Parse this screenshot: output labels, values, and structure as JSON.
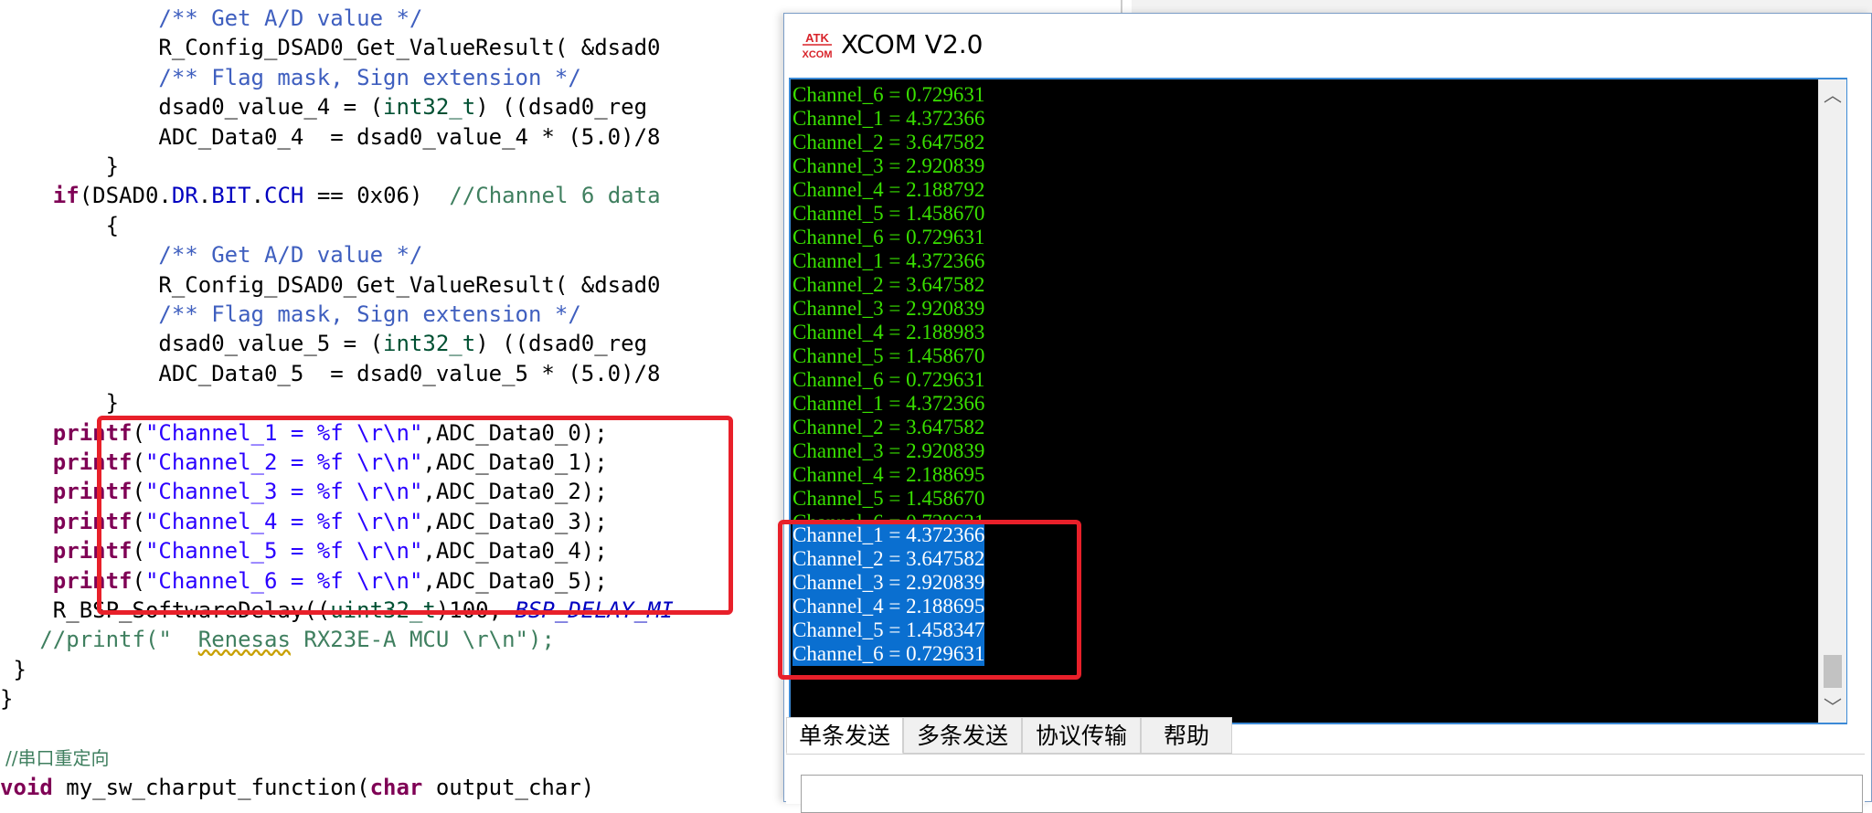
{
  "editor": {
    "lines": [
      {
        "indent": "            ",
        "parts": [
          {
            "t": "/** Get A/D value */",
            "c": "comment"
          }
        ]
      },
      {
        "indent": "            ",
        "parts": [
          {
            "t": "R_Config_DSAD0_Get_ValueResult( &dsad0",
            "c": ""
          }
        ]
      },
      {
        "indent": "            ",
        "parts": [
          {
            "t": "/** Flag mask, Sign extension */",
            "c": "comment"
          }
        ]
      },
      {
        "indent": "            ",
        "parts": [
          {
            "t": "dsad0_value_4 = (",
            "c": ""
          },
          {
            "t": "int32_t",
            "c": "type"
          },
          {
            "t": ") ((dsad0_reg",
            "c": ""
          }
        ]
      },
      {
        "indent": "            ",
        "parts": [
          {
            "t": "ADC_Data0_4  = dsad0_value_4 * (5.0)/8",
            "c": ""
          }
        ]
      },
      {
        "indent": "        ",
        "parts": [
          {
            "t": "}",
            "c": ""
          }
        ]
      },
      {
        "indent": "    ",
        "parts": [
          {
            "t": "if",
            "c": "kw"
          },
          {
            "t": "(DSAD0.",
            "c": ""
          },
          {
            "t": "DR",
            "c": "field"
          },
          {
            "t": ".",
            "c": ""
          },
          {
            "t": "BIT",
            "c": "field"
          },
          {
            "t": ".",
            "c": ""
          },
          {
            "t": "CCH",
            "c": "field"
          },
          {
            "t": " == 0x06)  ",
            "c": ""
          },
          {
            "t": "//Channel 6 data",
            "c": "green"
          }
        ]
      },
      {
        "indent": "        ",
        "parts": [
          {
            "t": "{",
            "c": ""
          }
        ]
      },
      {
        "indent": "            ",
        "parts": [
          {
            "t": "/** Get A/D value */",
            "c": "comment"
          }
        ]
      },
      {
        "indent": "            ",
        "parts": [
          {
            "t": "R_Config_DSAD0_Get_ValueResult( &dsad0",
            "c": ""
          }
        ]
      },
      {
        "indent": "            ",
        "parts": [
          {
            "t": "/** Flag mask, Sign extension */",
            "c": "comment"
          }
        ]
      },
      {
        "indent": "            ",
        "parts": [
          {
            "t": "dsad0_value_5 = (",
            "c": ""
          },
          {
            "t": "int32_t",
            "c": "type"
          },
          {
            "t": ") ((dsad0_reg",
            "c": ""
          }
        ]
      },
      {
        "indent": "            ",
        "parts": [
          {
            "t": "ADC_Data0_5  = dsad0_value_5 * (5.0)/8",
            "c": ""
          }
        ]
      },
      {
        "indent": "        ",
        "parts": [
          {
            "t": "}",
            "c": ""
          }
        ]
      },
      {
        "indent": "    ",
        "parts": [
          {
            "t": "printf",
            "c": "kw"
          },
          {
            "t": "(",
            "c": ""
          },
          {
            "t": "\"Channel_1 = %f \\r\\n\"",
            "c": "str"
          },
          {
            "t": ",ADC_Data0_0);",
            "c": ""
          }
        ]
      },
      {
        "indent": "    ",
        "parts": [
          {
            "t": "printf",
            "c": "kw"
          },
          {
            "t": "(",
            "c": ""
          },
          {
            "t": "\"Channel_2 = %f \\r\\n\"",
            "c": "str"
          },
          {
            "t": ",ADC_Data0_1);",
            "c": ""
          }
        ]
      },
      {
        "indent": "    ",
        "parts": [
          {
            "t": "printf",
            "c": "kw"
          },
          {
            "t": "(",
            "c": ""
          },
          {
            "t": "\"Channel_3 = %f \\r\\n\"",
            "c": "str"
          },
          {
            "t": ",ADC_Data0_2);",
            "c": ""
          }
        ]
      },
      {
        "indent": "    ",
        "parts": [
          {
            "t": "printf",
            "c": "kw"
          },
          {
            "t": "(",
            "c": ""
          },
          {
            "t": "\"Channel_4 = %f \\r\\n\"",
            "c": "str"
          },
          {
            "t": ",ADC_Data0_3);",
            "c": ""
          }
        ]
      },
      {
        "indent": "    ",
        "parts": [
          {
            "t": "printf",
            "c": "kw"
          },
          {
            "t": "(",
            "c": ""
          },
          {
            "t": "\"Channel_5 = %f \\r\\n\"",
            "c": "str"
          },
          {
            "t": ",ADC_Data0_4);",
            "c": ""
          }
        ]
      },
      {
        "indent": "    ",
        "parts": [
          {
            "t": "printf",
            "c": "kw"
          },
          {
            "t": "(",
            "c": ""
          },
          {
            "t": "\"Channel_6 = %f \\r\\n\"",
            "c": "str"
          },
          {
            "t": ",ADC_Data0_5);",
            "c": ""
          }
        ]
      },
      {
        "indent": "    ",
        "parts": [
          {
            "t": "R_BSP_SoftwareDelay((",
            "c": ""
          },
          {
            "t": "uint32_t",
            "c": "type"
          },
          {
            "t": ")100, ",
            "c": ""
          },
          {
            "t": "BSP_DELAY_MI",
            "c": "ital"
          }
        ]
      },
      {
        "indent": "   ",
        "parts": [
          {
            "t": "//printf(\"  ",
            "c": "green"
          },
          {
            "t": "Renesas",
            "c": "green-under"
          },
          {
            "t": " RX23E-A MCU \\r\\n\");",
            "c": "green"
          }
        ]
      },
      {
        "indent": " ",
        "parts": [
          {
            "t": "}",
            "c": ""
          }
        ]
      },
      {
        "indent": "",
        "parts": [
          {
            "t": "}",
            "c": ""
          }
        ]
      },
      {
        "indent": "",
        "parts": []
      },
      {
        "indent": "",
        "parts": []
      },
      {
        "indent": "",
        "parts": [
          {
            "t": "void",
            "c": "kw"
          },
          {
            "t": " my_sw_charput_function(",
            "c": ""
          },
          {
            "t": "char",
            "c": "kw"
          },
          {
            "t": " output_char)",
            "c": ""
          }
        ]
      }
    ],
    "chinese_comment": "//串口重定向"
  },
  "xcom": {
    "title": "XCOM V2.0",
    "logo_top": "ATK",
    "logo_bottom": "XCOM",
    "terminal_lines": [
      "Channel_6 = 0.729631",
      "Channel_1 = 4.372366",
      "Channel_2 = 3.647582",
      "Channel_3 = 2.920839",
      "Channel_4 = 2.188792",
      "Channel_5 = 1.458670",
      "Channel_6 = 0.729631",
      "Channel_1 = 4.372366",
      "Channel_2 = 3.647582",
      "Channel_3 = 2.920839",
      "Channel_4 = 2.188983",
      "Channel_5 = 1.458670",
      "Channel_6 = 0.729631",
      "Channel_1 = 4.372366",
      "Channel_2 = 3.647582",
      "Channel_3 = 2.920839",
      "Channel_4 = 2.188695",
      "Channel_5 = 1.458670",
      "Channel_6 = 0.729631"
    ],
    "selected_lines": [
      "Channel_1 = 4.372366",
      "Channel_2 = 3.647582",
      "Channel_3 = 2.920839",
      "Channel_4 = 2.188695",
      "Channel_5 = 1.458347",
      "Channel_6 = 0.729631"
    ],
    "tabs": [
      "单条发送",
      "多条发送",
      "协议传输",
      "帮助"
    ],
    "active_tab": "单条发送"
  },
  "colors": {
    "terminal_text": "#39e000",
    "terminal_bg": "#000000",
    "selection": "#0a6fd0",
    "highlight_border": "#e8202a"
  }
}
